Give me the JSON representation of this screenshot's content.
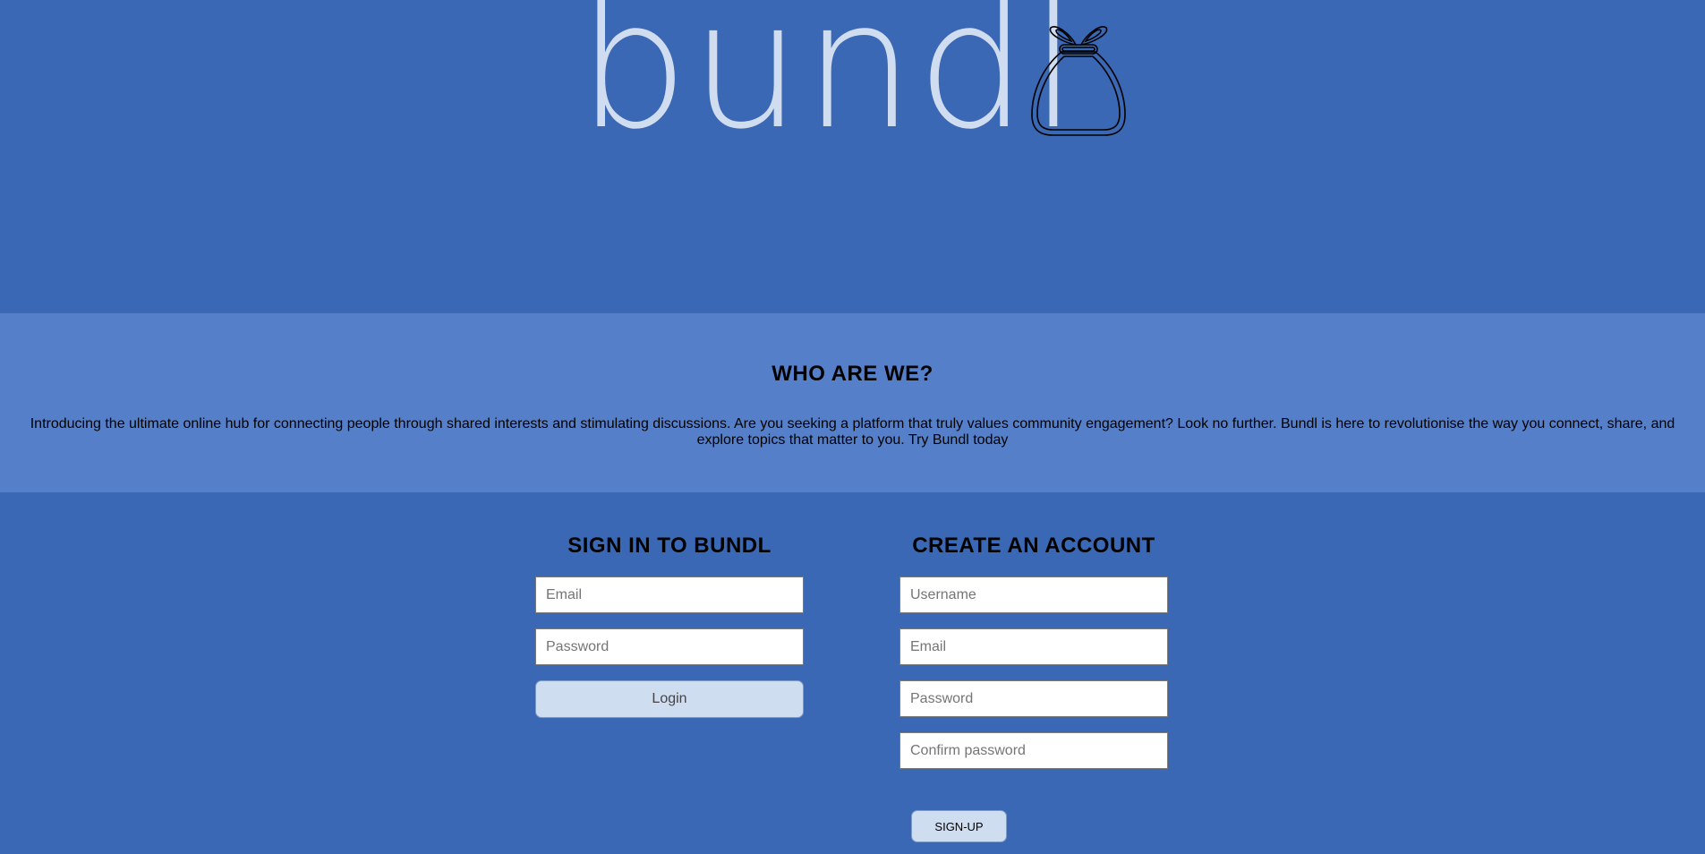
{
  "logo": {
    "wordmark": "bundl",
    "icon": "money-bag-icon",
    "text_color": "#d0ddf0"
  },
  "about": {
    "title": "WHO ARE WE?",
    "text": "Introducing the ultimate online hub for connecting people through shared interests and stimulating discussions. Are you seeking a platform that truly values community engagement? Look no further. Bundl is here to revolutionise the way you connect, share, and explore topics that matter to you. Try Bundl today"
  },
  "signin": {
    "title": "SIGN IN TO BUNDL",
    "email_placeholder": "Email",
    "password_placeholder": "Password",
    "button_label": "Login"
  },
  "signup": {
    "title": "CREATE AN ACCOUNT",
    "username_placeholder": "Username",
    "email_placeholder": "Email",
    "password_placeholder": "Password",
    "confirm_placeholder": "Confirm password",
    "button_label": "SIGN-UP"
  },
  "colors": {
    "background": "#3a68b4",
    "about_band": "#5580c9",
    "button": "#cfddf0"
  }
}
